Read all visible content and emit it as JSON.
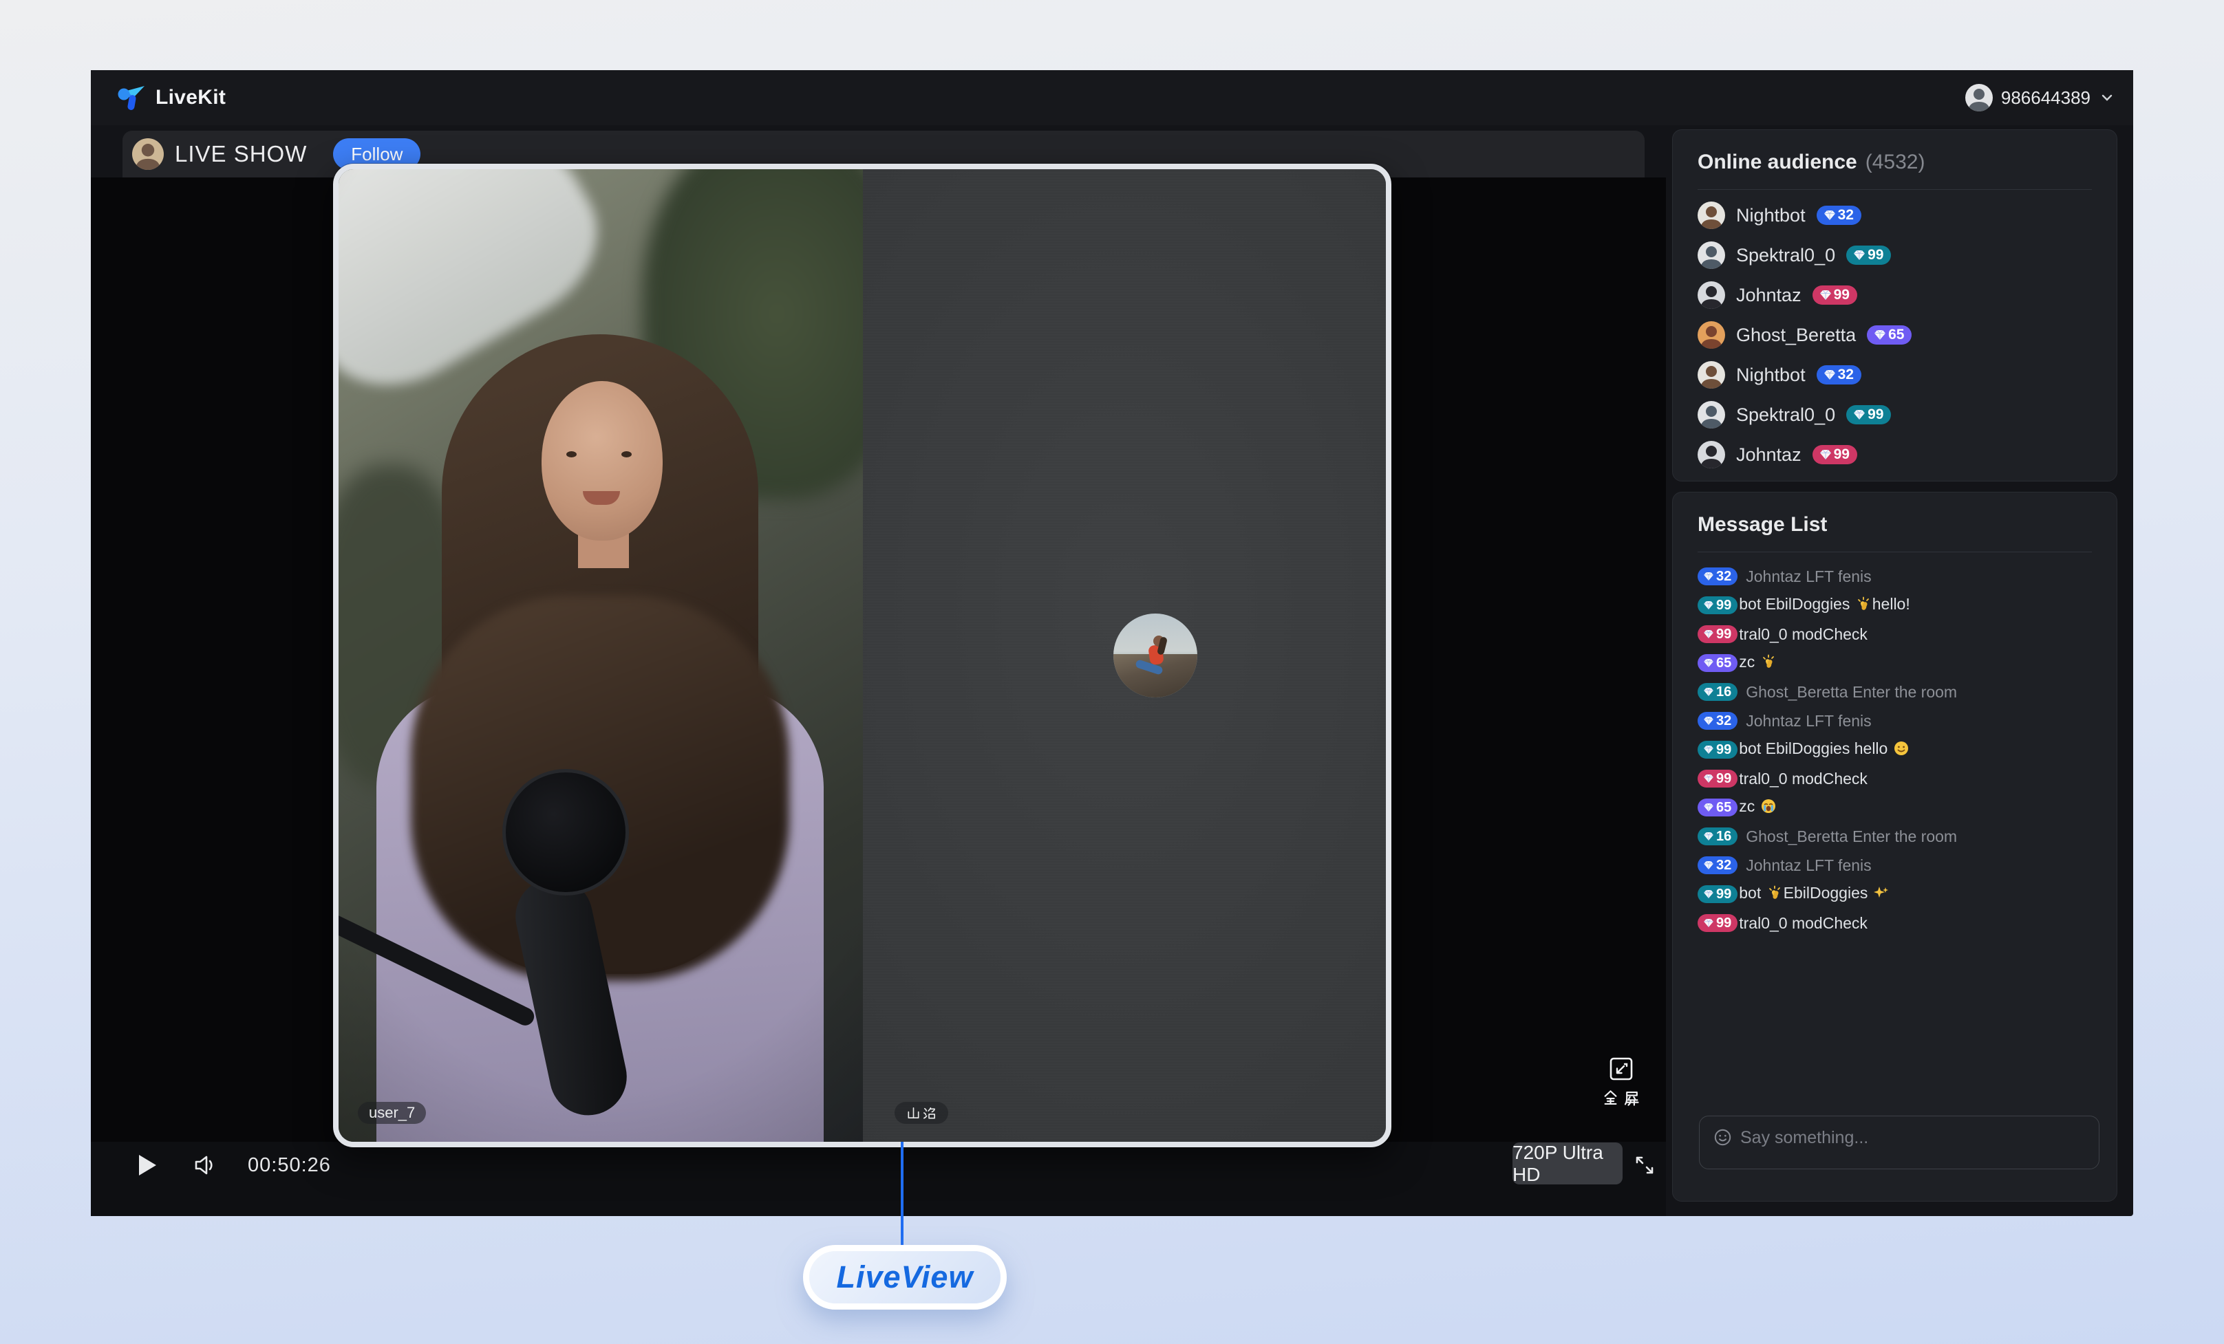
{
  "top_bar": {
    "brand": "LiveKit",
    "user_id": "986644389",
    "avatar": {
      "bg": "#e3e4e6",
      "fg": "#596068"
    }
  },
  "stream_header": {
    "title": "LIVE SHOW",
    "follow_label": "Follow",
    "avatar": {
      "bg": "#cdb795",
      "fg": "#6e5646"
    }
  },
  "player": {
    "local_name": "user_7",
    "remote_name": "山治",
    "time": "00:50:26",
    "quality": "720P Ultra HD",
    "fullscreen_label": "全屏"
  },
  "audience": {
    "title": "Online audience",
    "count": "(4532)",
    "members": [
      {
        "name": "Nightbot",
        "badge": "32",
        "badge_color": "blue",
        "avatar": {
          "bg": "#e6e4df",
          "fg": "#6e4f3a"
        }
      },
      {
        "name": "Spektral0_0",
        "badge": "99",
        "badge_color": "teal",
        "avatar": {
          "bg": "#e2e3e5",
          "fg": "#4e5a66"
        }
      },
      {
        "name": "Johntaz",
        "badge": "99",
        "badge_color": "pink",
        "avatar": {
          "bg": "#d8dade",
          "fg": "#27272d"
        }
      },
      {
        "name": "Ghost_Beretta",
        "badge": "65",
        "badge_color": "purple",
        "avatar": {
          "bg": "#e3a05c",
          "fg": "#7a432e"
        }
      },
      {
        "name": "Nightbot",
        "badge": "32",
        "badge_color": "blue",
        "avatar": {
          "bg": "#e6e4df",
          "fg": "#6e4f3a"
        }
      },
      {
        "name": "Spektral0_0",
        "badge": "99",
        "badge_color": "teal",
        "avatar": {
          "bg": "#e2e3e5",
          "fg": "#4e5a66"
        }
      },
      {
        "name": "Johntaz",
        "badge": "99",
        "badge_color": "pink",
        "avatar": {
          "bg": "#d8dade",
          "fg": "#27272d"
        }
      }
    ]
  },
  "messages": {
    "title": "Message List",
    "items": [
      {
        "badge": "32",
        "badge_color": "blue",
        "text": "Johntaz LFT fenis",
        "muted": true,
        "tight": false
      },
      {
        "badge": "99",
        "badge_color": "teal",
        "text": "bot EbilDoggies 👏hello!",
        "muted": false,
        "tight": true
      },
      {
        "badge": "99",
        "badge_color": "pink",
        "text": "tral0_0 modCheck",
        "muted": false,
        "tight": true
      },
      {
        "badge": "65",
        "badge_color": "purple",
        "text": "zc 👏",
        "muted": false,
        "tight": true
      },
      {
        "badge": "16",
        "badge_color": "teal",
        "text": "Ghost_Beretta Enter the room",
        "muted": true,
        "tight": false
      },
      {
        "badge": "32",
        "badge_color": "blue",
        "text": "Johntaz LFT fenis",
        "muted": true,
        "tight": false
      },
      {
        "badge": "99",
        "badge_color": "teal",
        "text": "bot EbilDoggies hello 😊",
        "muted": false,
        "tight": true
      },
      {
        "badge": "99",
        "badge_color": "pink",
        "text": "tral0_0 modCheck",
        "muted": false,
        "tight": true
      },
      {
        "badge": "65",
        "badge_color": "purple",
        "text": "zc 😭",
        "muted": false,
        "tight": true
      },
      {
        "badge": "16",
        "badge_color": "teal",
        "text": "Ghost_Beretta Enter the room",
        "muted": true,
        "tight": false
      },
      {
        "badge": "32",
        "badge_color": "blue",
        "text": "Johntaz LFT fenis",
        "muted": true,
        "tight": false
      },
      {
        "badge": "99",
        "badge_color": "teal",
        "text": "bot 👏EbilDoggies ✨",
        "muted": false,
        "tight": true
      },
      {
        "badge": "99",
        "badge_color": "pink",
        "text": "tral0_0 modCheck",
        "muted": false,
        "tight": true
      }
    ]
  },
  "chat_input": {
    "placeholder": "Say something..."
  },
  "callout": {
    "label": "LiveView"
  },
  "colors": {
    "blue": "#2b63e8",
    "teal": "#0e8095",
    "pink": "#ce3765",
    "purple": "#6f5cf3",
    "accent": "#3d7ef5"
  }
}
